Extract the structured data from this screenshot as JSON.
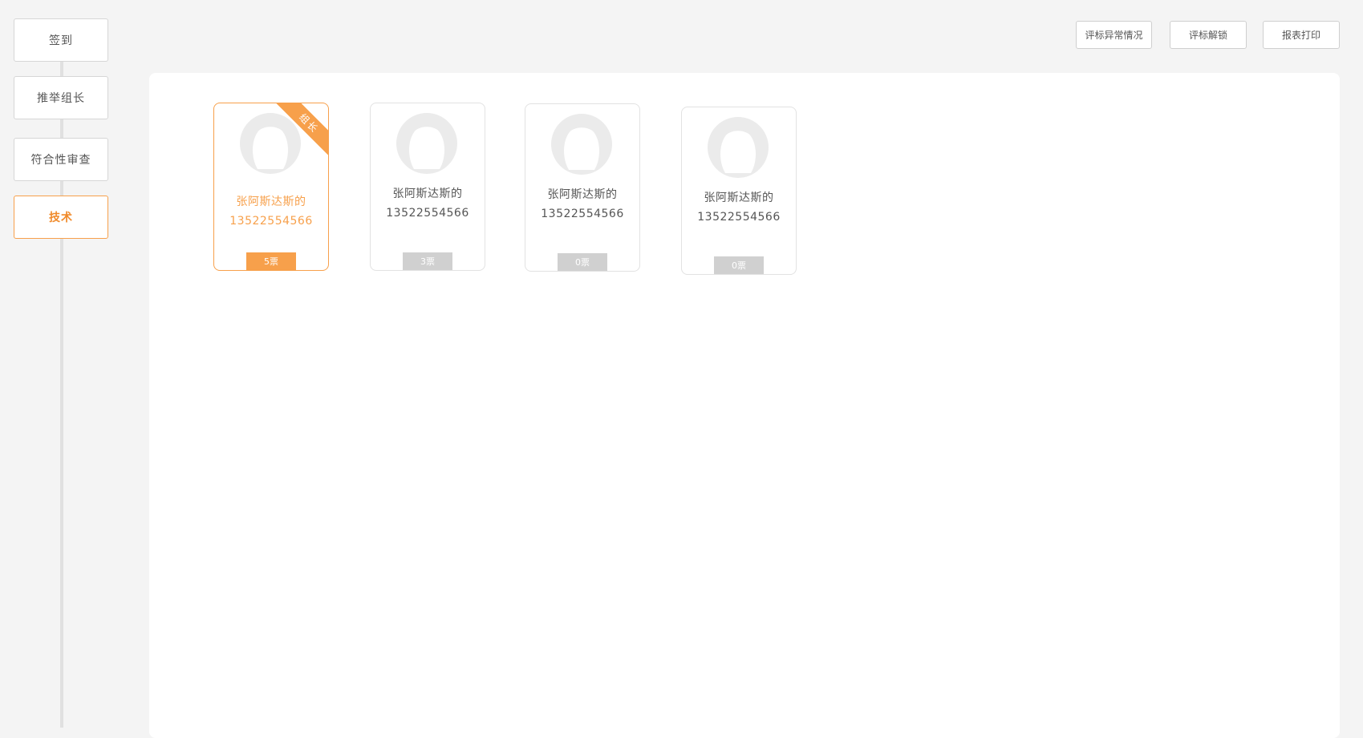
{
  "sidebar": {
    "steps": [
      {
        "label": "签到"
      },
      {
        "label": "推举组长"
      },
      {
        "label": "符合性审查"
      },
      {
        "label": "技术"
      }
    ]
  },
  "toolbar": {
    "abnormal_label": "评标异常情况",
    "unlock_label": "评标解锁",
    "print_label": "报表打印"
  },
  "cards": [
    {
      "name": "张阿斯达斯的",
      "phone": "13522554566",
      "votes": "5票",
      "ribbon": "组长"
    },
    {
      "name": "张阿斯达斯的",
      "phone": "13522554566",
      "votes": "3票"
    },
    {
      "name": "张阿斯达斯的",
      "phone": "13522554566",
      "votes": "0票"
    },
    {
      "name": "张阿斯达斯的",
      "phone": "13522554566",
      "votes": "0票"
    }
  ],
  "colors": {
    "accent": "#f7a04b",
    "background": "#f4f4f4",
    "badge_inactive": "#d0d0d0"
  }
}
